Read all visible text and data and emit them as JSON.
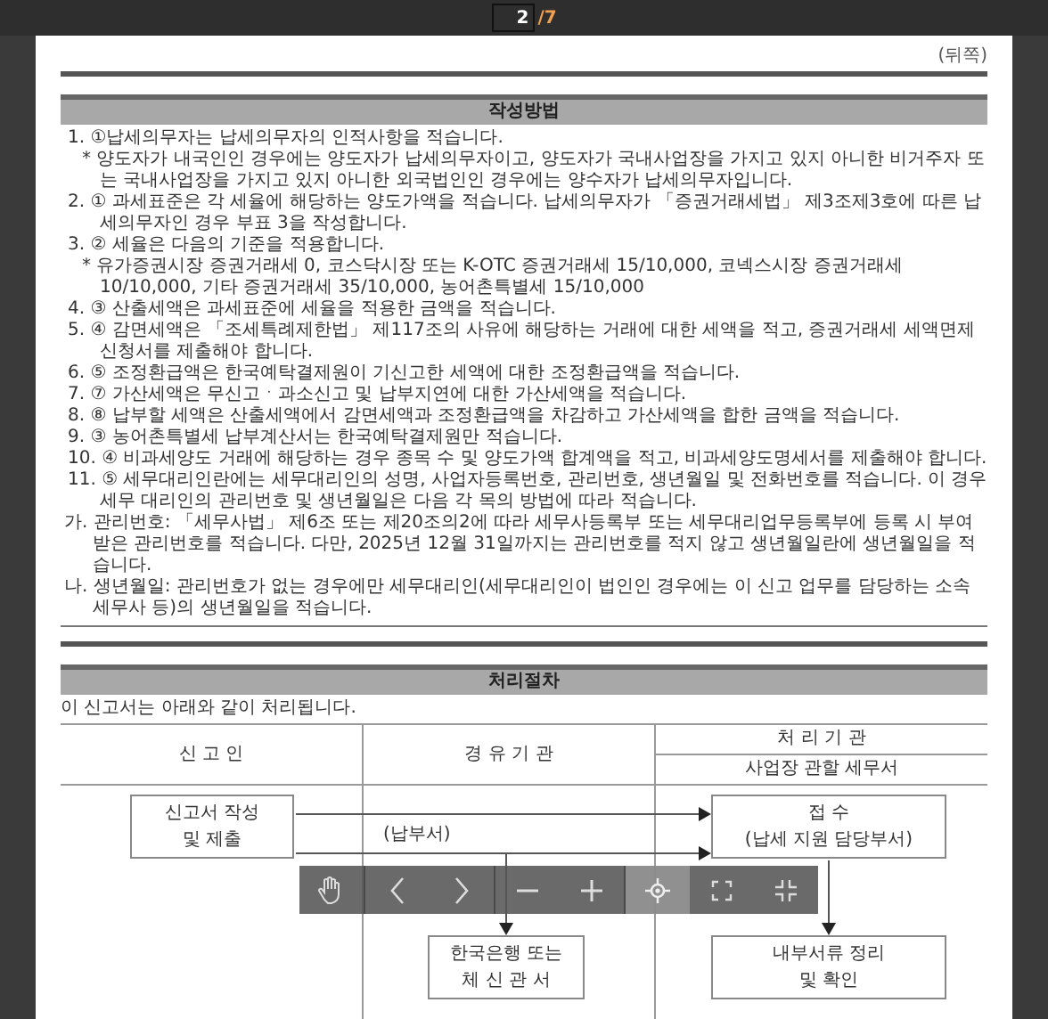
{
  "viewer": {
    "current_page": "2",
    "page_total": "/7"
  },
  "document": {
    "page_side": "(뒤쪽)",
    "instructions": {
      "title": "작성방법",
      "items": [
        {
          "kind": "item",
          "text": "1. ①납세의무자는 납세의무자의 인적사항을 적습니다."
        },
        {
          "kind": "bullet",
          "text": "* 양도자가 내국인인 경우에는 양도자가 납세의무자이고, 양도자가 국내사업장을 가지고 있지 아니한 비거주자 또는 국내사업장을 가지고 있지 아니한 외국법인인 경우에는 양수자가 납세의무자입니다."
        },
        {
          "kind": "item",
          "text": "2. ① 과세표준은 각 세율에 해당하는 양도가액을 적습니다. 납세의무자가 「증권거래세법」 제3조제3호에 따른 납세의무자인 경우 부표 3을 작성합니다."
        },
        {
          "kind": "item",
          "text": "3. ② 세율은 다음의 기준을 적용합니다."
        },
        {
          "kind": "bullet",
          "text": "* 유가증권시장 증권거래세 0, 코스닥시장 또는 K-OTC 증권거래세 15/10,000, 코넥스시장 증권거래세 10/10,000, 기타 증권거래세 35/10,000, 농어촌특별세 15/10,000"
        },
        {
          "kind": "item",
          "text": "4. ③ 산출세액은 과세표준에 세율을 적용한 금액을 적습니다."
        },
        {
          "kind": "item",
          "text": "5. ④ 감면세액은 「조세특례제한법」 제117조의 사유에 해당하는 거래에 대한 세액을 적고, 증권거래세 세액면제신청서를 제출해야 합니다."
        },
        {
          "kind": "item",
          "text": "6. ⑤ 조정환급액은 한국예탁결제원이 기신고한 세액에 대한 조정환급액을 적습니다."
        },
        {
          "kind": "item",
          "text": "7. ⑦ 가산세액은 무신고ㆍ과소신고 및 납부지연에 대한 가산세액을 적습니다."
        },
        {
          "kind": "item",
          "text": "8. ⑧ 납부할 세액은 산출세액에서 감면세액과 조정환급액을 차감하고 가산세액을 합한 금액을 적습니다."
        },
        {
          "kind": "item",
          "text": "9. ③ 농어촌특별세 납부계산서는 한국예탁결제원만 적습니다."
        },
        {
          "kind": "item",
          "text": "10. ④ 비과세양도 거래에 해당하는 경우 종목 수 및 양도가액 합계액을 적고, 비과세양도명세서를 제출해야 합니다."
        },
        {
          "kind": "item",
          "text": "11. ⑤ 세무대리인란에는 세무대리인의 성명, 사업자등록번호, 관리번호, 생년월일 및 전화번호를 적습니다. 이 경우 세무 대리인의 관리번호 및 생년월일은 다음 각 목의 방법에 따라 적습니다."
        },
        {
          "kind": "sub",
          "text": "가. 관리번호: 「세무사법」 제6조 또는 제20조의2에 따라 세무사등록부 또는 세무대리업무등록부에 등록 시 부여받은 관리번호를 적습니다. 다만, 2025년 12월 31일까지는 관리번호를 적지 않고 생년월일란에 생년월일을 적습니다."
        },
        {
          "kind": "sub",
          "text": "나. 생년월일: 관리번호가 없는 경우에만 세무대리인(세무대리인이 법인인 경우에는 이 신고 업무를 담당하는 소속 세무사 등)의 생년월일을 적습니다."
        }
      ]
    },
    "procedure": {
      "title": "처리절차",
      "intro": "이 신고서는 아래와 같이 처리됩니다.",
      "columns": [
        "신 고 인",
        "경 유 기 관",
        "처 리 기 관"
      ],
      "processor_office": "사업장 관할 세무서",
      "boxes": [
        {
          "kind": "filer",
          "lines": [
            "신고서 작성",
            "및 제출"
          ]
        },
        {
          "kind": "receipt",
          "lines": [
            "접 수",
            "(납세 지원 담당부서)"
          ]
        },
        {
          "kind": "bank",
          "lines": [
            "한국은행 또는",
            "체 신 관 서"
          ]
        },
        {
          "kind": "review",
          "lines": [
            "내부서류 정리",
            "및 확인"
          ]
        }
      ],
      "payment_label": "(납부서)"
    }
  },
  "toolbar": {
    "tools": [
      {
        "kind": "hand",
        "selected": false
      },
      {
        "kind": "prev",
        "selected": false
      },
      {
        "kind": "next",
        "selected": false
      },
      {
        "kind": "zoom-out",
        "selected": false
      },
      {
        "kind": "zoom-in",
        "selected": false
      },
      {
        "kind": "fit",
        "selected": true
      },
      {
        "kind": "fullscreen",
        "selected": false
      },
      {
        "kind": "exit-fullscreen",
        "selected": false
      }
    ]
  }
}
